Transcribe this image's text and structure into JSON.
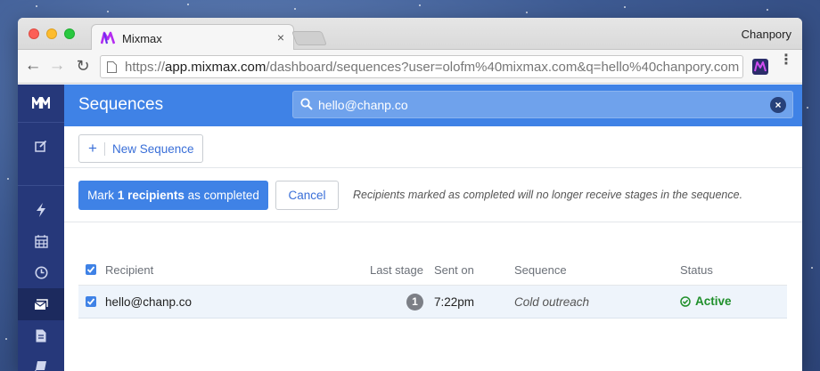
{
  "browser": {
    "tab_title": "Mixmax",
    "tab_close": "×",
    "user_name": "Chanpory",
    "url_scheme": "https://",
    "url_host": "app.mixmax.com",
    "url_path": "/dashboard/sequences?user=olofm%40mixmax.com&q=hello%40chanpory.com",
    "nav_back": "←",
    "nav_forward": "→",
    "nav_reload": "↻",
    "menu": "⋮"
  },
  "header": {
    "title": "Sequences",
    "search_value": "hello@chanp.co",
    "search_clear": "×"
  },
  "toolbar": {
    "new_sequence_icon": "+",
    "new_sequence_label": "New Sequence"
  },
  "bulk_action": {
    "mark_prefix": "Mark",
    "mark_bold": "1 recipients",
    "mark_suffix": "as completed",
    "cancel_label": "Cancel",
    "note": "Recipients marked as completed will no longer receive stages in the sequence."
  },
  "table": {
    "headers": {
      "recipient": "Recipient",
      "last_stage": "Last stage",
      "sent_on": "Sent on",
      "sequence": "Sequence",
      "status": "Status"
    },
    "rows": [
      {
        "recipient": "hello@chanp.co",
        "last_stage": "1",
        "sent_on": "7:22pm",
        "sequence": "Cold outreach",
        "status": "Active",
        "checked": true
      }
    ]
  },
  "sidebar": {
    "items": [
      "mixmax-logo-icon",
      "compose-icon",
      "lightning-icon",
      "calendar-icon",
      "clock-icon",
      "sequences-icon",
      "document-icon",
      "book-icon"
    ]
  },
  "colors": {
    "header_blue": "#3f82e6",
    "sidebar_navy": "#26387a",
    "status_green": "#1f8f2a",
    "brand_purple": "#7a2cf0"
  }
}
